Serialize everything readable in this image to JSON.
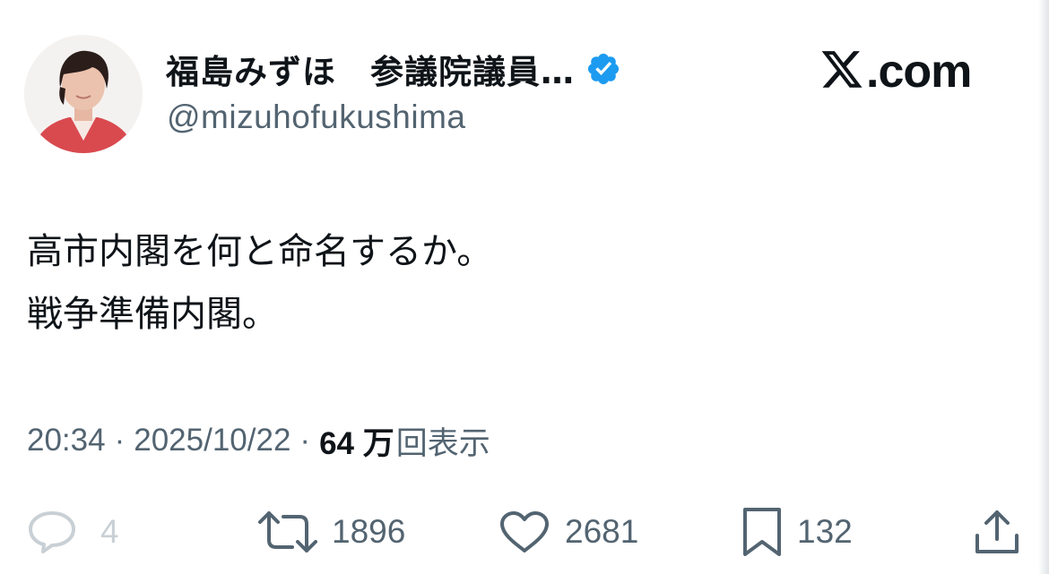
{
  "author": {
    "display_name": "福島みずほ　参議院議員…",
    "handle": "@mizuhofukushima",
    "verified_icon": "verified-badge-icon",
    "avatar": "profile-photo"
  },
  "brand": {
    "logo_icon": "x-logo-icon",
    "text": ".com"
  },
  "tweet": {
    "lines": [
      "高市内閣を何と命名するか。",
      "戦争準備内閣。"
    ]
  },
  "meta": {
    "time": "20:34",
    "separator": "·",
    "date": "2025/10/22",
    "views_count": "64 万",
    "views_label": "回表示"
  },
  "actions": {
    "reply": {
      "icon": "reply-icon",
      "count": "4"
    },
    "retweet": {
      "icon": "retweet-icon",
      "count": "1896"
    },
    "like": {
      "icon": "heart-icon",
      "count": "2681"
    },
    "bookmark": {
      "icon": "bookmark-icon",
      "count": "132"
    },
    "share": {
      "icon": "share-icon"
    }
  },
  "colors": {
    "text_primary": "#0f1419",
    "text_secondary": "#536471",
    "verified_blue": "#1d9bf0",
    "reply_faded": "#c9d0d5"
  }
}
